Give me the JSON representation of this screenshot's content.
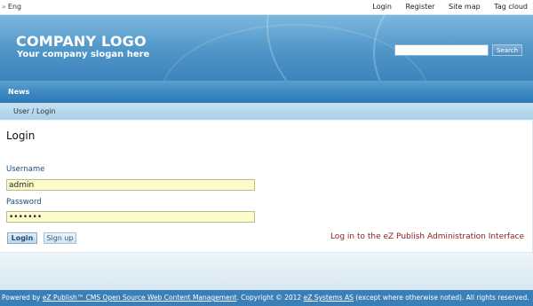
{
  "topbar": {
    "language": "Eng",
    "links": [
      "Login",
      "Register",
      "Site map",
      "Tag cloud"
    ]
  },
  "header": {
    "logo": "COMPANY LOGO",
    "slogan": "Your company slogan here",
    "search_value": "",
    "search_button": "Search"
  },
  "nav": {
    "items": [
      "News"
    ]
  },
  "breadcrumb": "User / Login",
  "login": {
    "title": "Login",
    "username_label": "Username",
    "username_value": "admin",
    "password_label": "Password",
    "password_value": "•••••••",
    "login_button": "Login",
    "signup_button": "Sign up",
    "admin_link": "Log in to the eZ Publish Administration Interface"
  },
  "footer": {
    "powered_by": "Powered by",
    "ez_link": "eZ Publish™ CMS Open Source Web Content Management",
    "copyright": ". Copyright © 2012",
    "systems_link": "eZ Systems AS",
    "rights": "(except where otherwise noted). All rights reserved."
  },
  "colors": {
    "header_blue": "#4f95c8",
    "nav_blue": "#3a86c0",
    "field_bg": "#fbfcc9",
    "admin_link": "#8b1d1d",
    "footer_bg": "#3a7fb8"
  }
}
